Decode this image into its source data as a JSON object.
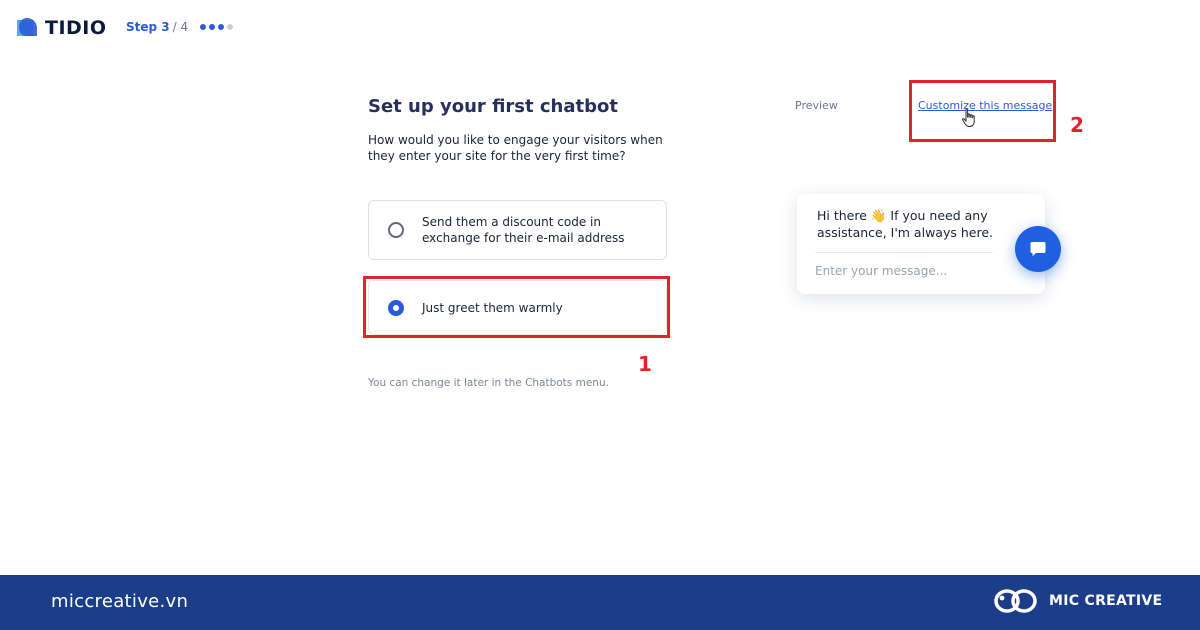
{
  "brand": {
    "name": "TIDIO",
    "color": "#2b5bd7"
  },
  "progress": {
    "current": "Step 3",
    "total": "/ 4",
    "steps_total": 4,
    "steps_done": 3
  },
  "setup": {
    "title": "Set up your first chatbot",
    "question": "How would you like to engage your visitors when they enter your site for the very first time?",
    "options": [
      {
        "label": "Send them a discount code in exchange for their e-mail address",
        "selected": false
      },
      {
        "label": "Just greet them warmly",
        "selected": true
      }
    ],
    "hint": "You can change it later in the Chatbots menu."
  },
  "preview": {
    "label": "Preview",
    "customize_link": "Customize this message",
    "greeting": "Hi there 👋 If you need any assistance, I'm always here.",
    "input_placeholder": "Enter your message...",
    "chat_button_icon": "chat-bubble-icon"
  },
  "annotations": {
    "callout_1": "1",
    "callout_2": "2",
    "color": "#e0242b"
  },
  "footer": {
    "domain": "miccreative.vn",
    "brand": "MIC CREATIVE",
    "background": "#1c3e88"
  }
}
